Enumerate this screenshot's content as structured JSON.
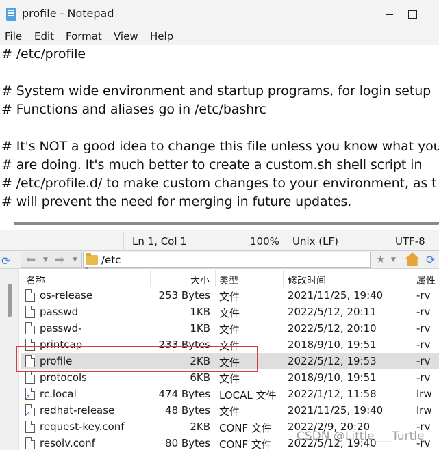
{
  "notepad": {
    "title": "profile - Notepad",
    "menu": [
      "File",
      "Edit",
      "Format",
      "View",
      "Help"
    ],
    "lines": [
      "# /etc/profile",
      "",
      "# System wide environment and startup programs, for login setup",
      "# Functions and aliases go in /etc/bashrc",
      "",
      "# It's NOT a good idea to change this file unless you know what you",
      "# are doing. It's much better to create a custom.sh shell script in",
      "# /etc/profile.d/ to make custom changes to your environment, as t",
      "# will prevent the need for merging in future updates."
    ],
    "status": {
      "position": "Ln 1, Col 1",
      "zoom": "100%",
      "line_ending": "Unix (LF)",
      "encoding": "UTF-8"
    }
  },
  "file_manager": {
    "path": "/etc",
    "columns": {
      "name": "名称",
      "size": "大小",
      "type": "类型",
      "modified": "修改时间",
      "attr": "属性"
    },
    "files": [
      {
        "name": "os-release",
        "size": "253 Bytes",
        "type": "文件",
        "modified": "2021/11/25, 19:40",
        "attr": "-rv",
        "link": false
      },
      {
        "name": "passwd",
        "size": "1KB",
        "type": "文件",
        "modified": "2022/5/12, 20:11",
        "attr": "-rv",
        "link": false
      },
      {
        "name": "passwd-",
        "size": "1KB",
        "type": "文件",
        "modified": "2022/5/12, 20:10",
        "attr": "-rv",
        "link": false
      },
      {
        "name": "printcap",
        "size": "233 Bytes",
        "type": "文件",
        "modified": "2018/9/10, 19:51",
        "attr": "-rv",
        "link": false
      },
      {
        "name": "profile",
        "size": "2KB",
        "type": "文件",
        "modified": "2022/5/12, 19:53",
        "attr": "-rv",
        "link": false,
        "selected": true
      },
      {
        "name": "protocols",
        "size": "6KB",
        "type": "文件",
        "modified": "2018/9/10, 19:51",
        "attr": "-rv",
        "link": false
      },
      {
        "name": "rc.local",
        "size": "474 Bytes",
        "type": "LOCAL 文件",
        "modified": "2022/1/12, 11:58",
        "attr": "lrw",
        "link": true
      },
      {
        "name": "redhat-release",
        "size": "48 Bytes",
        "type": "文件",
        "modified": "2021/11/25, 19:40",
        "attr": "lrw",
        "link": true
      },
      {
        "name": "request-key.conf",
        "size": "2KB",
        "type": "CONF 文件",
        "modified": "2022/2/9, 20:20",
        "attr": "-rv",
        "link": false
      },
      {
        "name": "resolv.conf",
        "size": "80 Bytes",
        "type": "CONF 文件",
        "modified": "2022/5/12, 19:40",
        "attr": "-rv",
        "link": false
      }
    ]
  },
  "watermark": "CSDN @Little___Turtle"
}
